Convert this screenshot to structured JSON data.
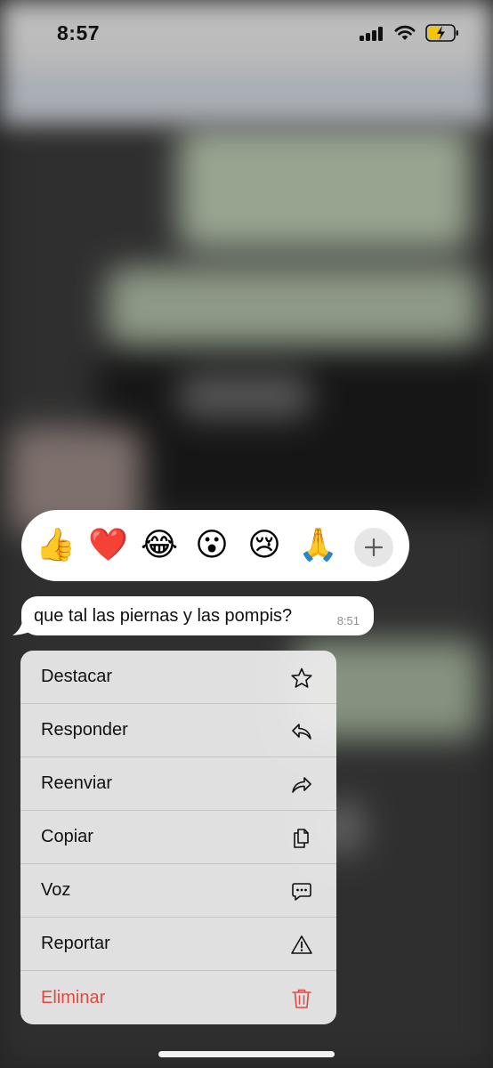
{
  "status_bar": {
    "time": "8:57",
    "icons": [
      "cellular-signal-icon",
      "wifi-icon",
      "battery-charging-icon"
    ]
  },
  "reactions": {
    "emojis": [
      "👍",
      "❤️",
      "😂",
      "😮",
      "😢",
      "🙏"
    ],
    "more_icon": "plus-icon"
  },
  "message": {
    "text": "que tal las piernas y las pompis?",
    "time": "8:51"
  },
  "menu": {
    "items": [
      {
        "label": "Destacar",
        "icon": "star-icon"
      },
      {
        "label": "Responder",
        "icon": "reply-icon"
      },
      {
        "label": "Reenviar",
        "icon": "forward-icon"
      },
      {
        "label": "Copiar",
        "icon": "copy-icon"
      },
      {
        "label": "Voz",
        "icon": "speech-bubble-icon"
      },
      {
        "label": "Reportar",
        "icon": "warning-icon"
      },
      {
        "label": "Eliminar",
        "icon": "trash-icon"
      }
    ],
    "danger_color": "#e5473e"
  }
}
